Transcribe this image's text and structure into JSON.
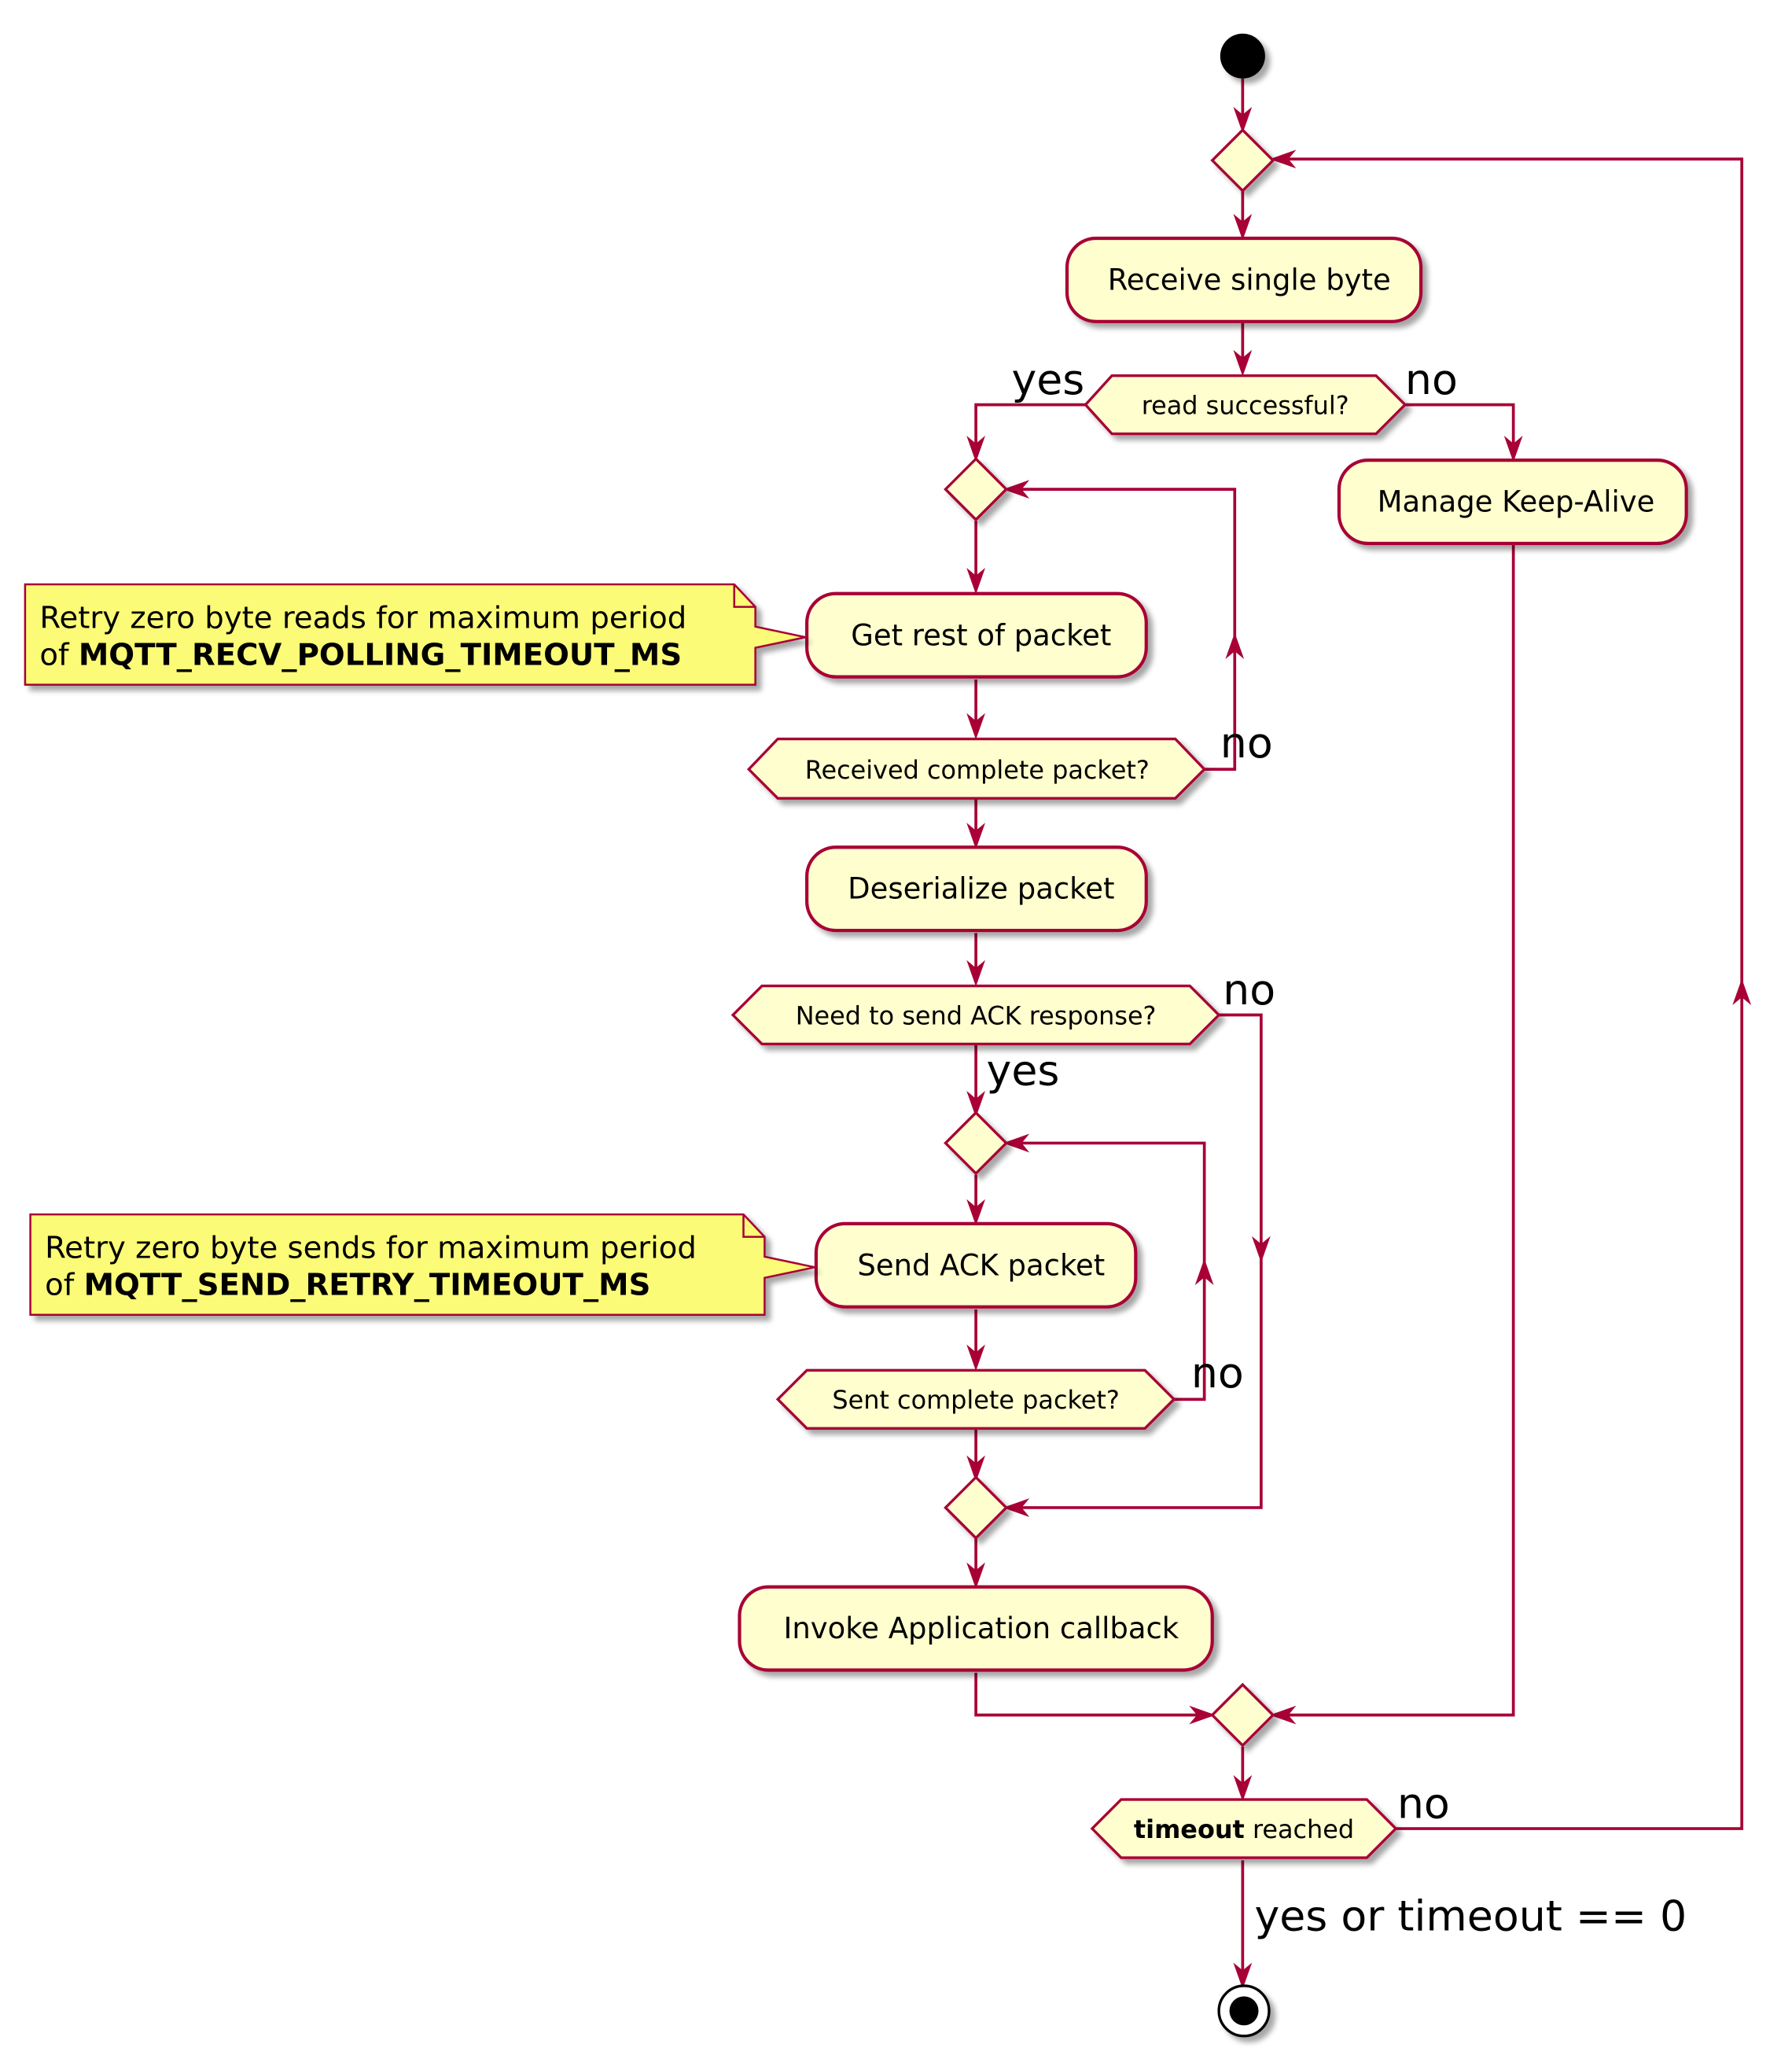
{
  "diagram": {
    "type": "activity",
    "colors": {
      "line": "#A80036",
      "activity_fill": "#FEFECE",
      "note_fill": "#FBFB77",
      "start_end": "#000000"
    },
    "activities": {
      "receive_byte": "Receive single byte",
      "manage_keepalive": "Manage Keep-Alive",
      "get_rest": "Get rest of packet",
      "deserialize": "Deserialize packet",
      "send_ack": "Send ACK packet",
      "invoke_callback": "Invoke Application callback"
    },
    "decisions": {
      "read_successful": "read successful?",
      "received_complete": "Received complete packet?",
      "need_ack": "Need to send ACK response?",
      "sent_complete": "Sent complete packet?",
      "timeout_bold": "timeout",
      "timeout_rest": " reached"
    },
    "labels": {
      "read_yes": "yes",
      "read_no": "no",
      "received_no": "no",
      "ack_no": "no",
      "ack_yes": "yes",
      "sent_no": "no",
      "timeout_no": "no",
      "timeout_yes": "yes or timeout == 0"
    },
    "notes": {
      "recv": {
        "line1": "Retry zero byte reads for maximum period",
        "prefix": "of ",
        "bold": "MQTT_RECV_POLLING_TIMEOUT_MS"
      },
      "send": {
        "line1": "Retry zero byte sends for maximum period",
        "prefix": "of ",
        "bold": "MQTT_SEND_RETRY_TIMEOUT_MS"
      }
    }
  }
}
